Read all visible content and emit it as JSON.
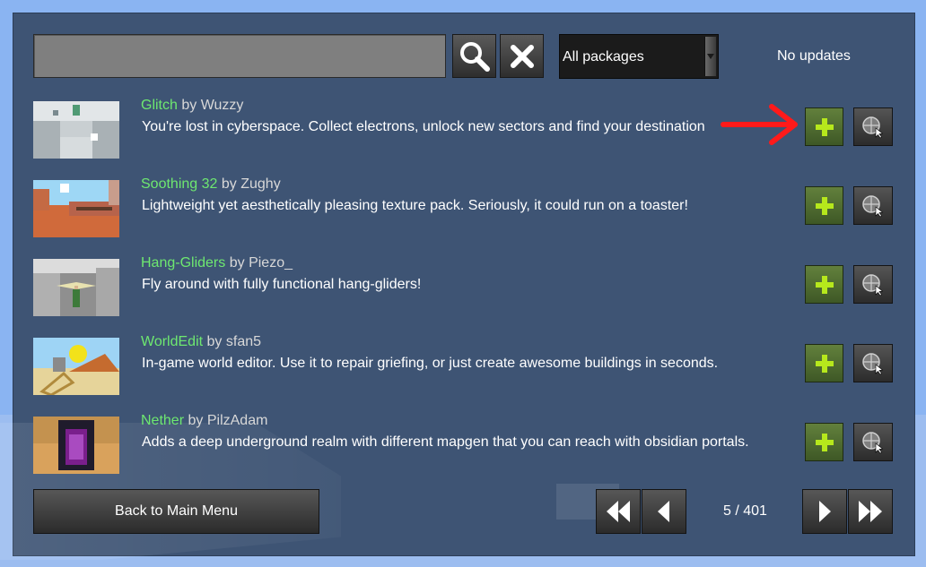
{
  "search": {
    "value": "",
    "placeholder": ""
  },
  "toolbar": {
    "search_icon": "search-icon",
    "clear_icon": "close-icon"
  },
  "filter": {
    "selected": "All packages"
  },
  "updates_status": "No updates",
  "packages": [
    {
      "name": "Glitch",
      "by": "by",
      "author": "Wuzzy",
      "description": "You're lost in cyberspace. Collect electrons, unlock new sectors and find your destination"
    },
    {
      "name": "Soothing 32",
      "by": "by",
      "author": "Zughy",
      "description": "Lightweight yet aesthetically pleasing texture pack. Seriously, it could run on a toaster!"
    },
    {
      "name": "Hang-Gliders",
      "by": "by",
      "author": "Piezo_",
      "description": "Fly around with fully functional hang-gliders!"
    },
    {
      "name": "WorldEdit",
      "by": "by",
      "author": "sfan5",
      "description": "In-game world editor. Use it to repair griefing, or just create awesome buildings in seconds."
    },
    {
      "name": "Nether",
      "by": "by",
      "author": "PilzAdam",
      "description": "Adds a deep underground realm with different mapgen that you can reach with obsidian portals."
    }
  ],
  "footer": {
    "back_label": "Back to Main Menu",
    "page": "5 / 401"
  },
  "colors": {
    "panel": "#3e5474",
    "name_green": "#6ee870",
    "install_green": "#62803c",
    "annotation_red": "#ff1a1a"
  }
}
